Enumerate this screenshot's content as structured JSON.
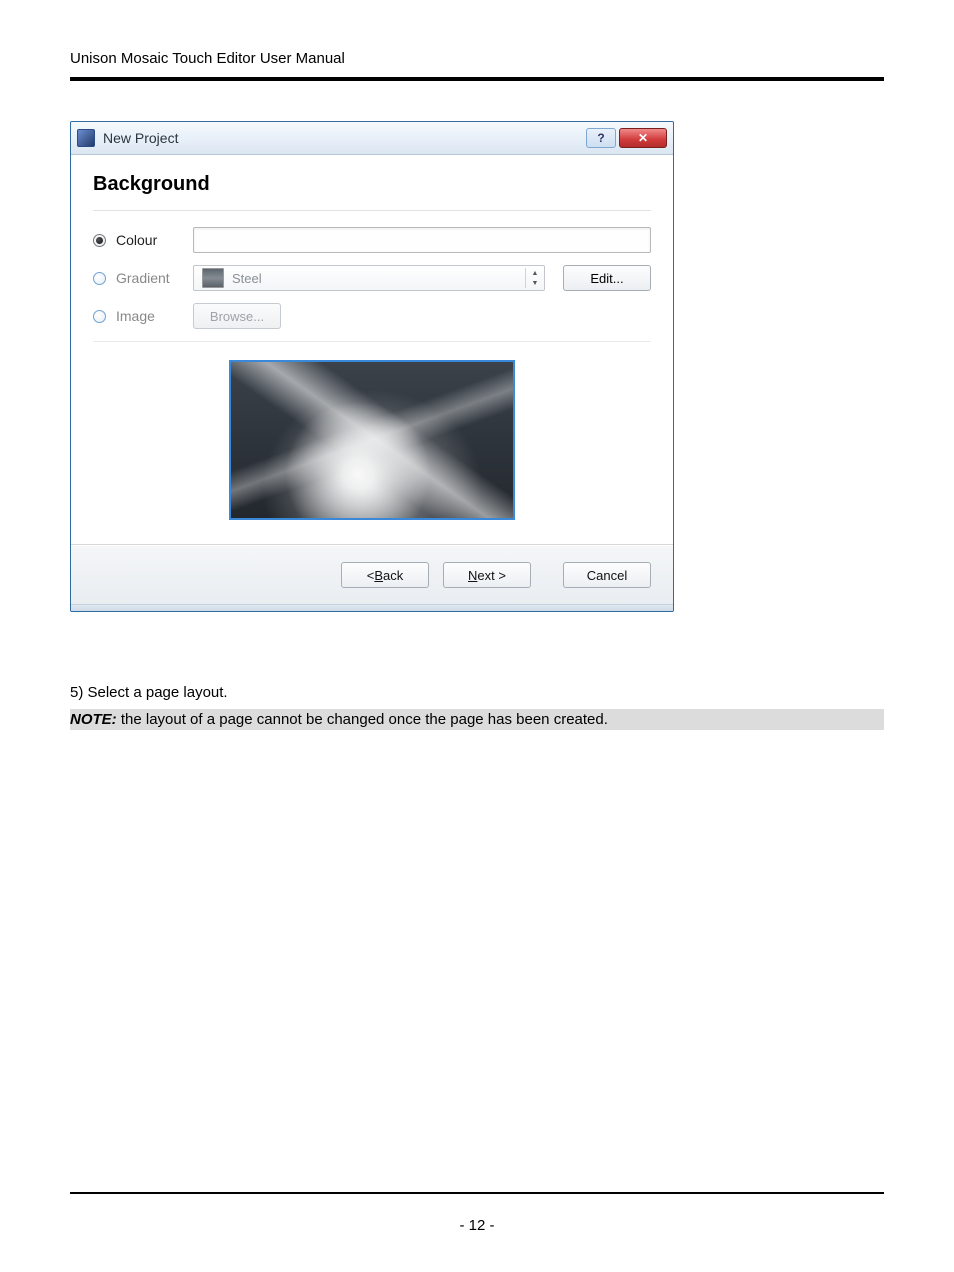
{
  "doc": {
    "header": "Unison Mosaic Touch Editor User Manual",
    "page_number": "- 12 -",
    "step_text": "5) Select a page layout.",
    "note_label": "NOTE:",
    "note_text": " the layout of a page cannot be changed once the page has been created."
  },
  "dialog": {
    "title": "New Project",
    "help_symbol": "?",
    "close_symbol": "✕",
    "section_title": "Background",
    "options": {
      "colour": {
        "label": "Colour",
        "checked": true
      },
      "gradient": {
        "label": "Gradient",
        "checked": false,
        "preset": "Steel",
        "edit_label": "Edit..."
      },
      "image": {
        "label": "Image",
        "checked": false,
        "browse_label": "Browse..."
      }
    },
    "buttons": {
      "back": "< Back",
      "back_key": "B",
      "next": "Next >",
      "next_key": "N",
      "cancel": "Cancel"
    }
  }
}
